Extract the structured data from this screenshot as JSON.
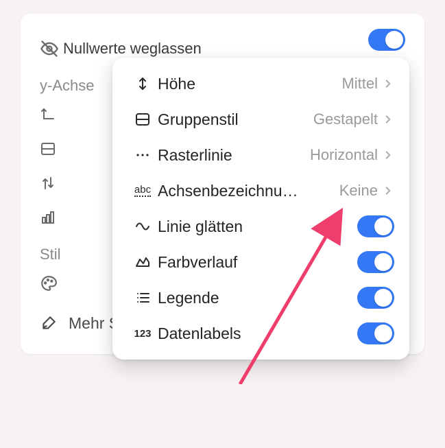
{
  "top_row": {
    "label": "Nullwerte weglassen",
    "toggle": true
  },
  "section_y": "y-Achse",
  "more_row": {
    "label": "Mehr Stil-Optionen"
  },
  "section_style": "Stil",
  "popover": {
    "items": [
      {
        "kind": "nav",
        "icon": "arrows-vertical-icon",
        "label": "Höhe",
        "value": "Mittel"
      },
      {
        "kind": "nav",
        "icon": "split-horizontal-icon",
        "label": "Gruppenstil",
        "value": "Gestapelt"
      },
      {
        "kind": "nav",
        "icon": "dots-icon",
        "label": "Rasterlinie",
        "value": "Horizontal"
      },
      {
        "kind": "nav",
        "icon": "abc-icon",
        "label": "Achsenbezeichnu…",
        "value": "Keine"
      },
      {
        "kind": "toggle",
        "icon": "wave-icon",
        "label": "Linie glätten",
        "on": true
      },
      {
        "kind": "toggle",
        "icon": "area-icon",
        "label": "Farbverlauf",
        "on": true
      },
      {
        "kind": "toggle",
        "icon": "list-icon",
        "label": "Legende",
        "on": true
      },
      {
        "kind": "toggle",
        "icon": "123-icon",
        "label": "Datenlabels",
        "on": true
      }
    ]
  }
}
